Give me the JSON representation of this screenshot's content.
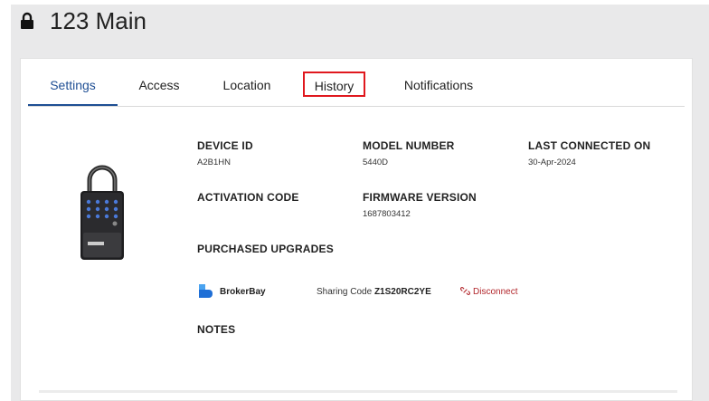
{
  "page": {
    "title": "123 Main"
  },
  "tabs": [
    {
      "label": "Settings"
    },
    {
      "label": "Access"
    },
    {
      "label": "Location"
    },
    {
      "label": "History"
    },
    {
      "label": "Notifications"
    }
  ],
  "fields": {
    "device_id": {
      "label": "DEVICE ID",
      "value": "A2B1HN"
    },
    "model_number": {
      "label": "MODEL NUMBER",
      "value": "5440D"
    },
    "last_connected": {
      "label": "LAST CONNECTED ON",
      "value": "30-Apr-2024"
    },
    "activation_code": {
      "label": "ACTIVATION CODE"
    },
    "firmware_version": {
      "label": "FIRMWARE VERSION",
      "value": "1687803412"
    },
    "purchased_upgrades": {
      "label": "PURCHASED UPGRADES"
    },
    "notes": {
      "label": "NOTES"
    }
  },
  "upgrade": {
    "name": "BrokerBay",
    "sharing_prefix": "Sharing Code",
    "sharing_code": "Z1S20RC2YE",
    "disconnect_label": "Disconnect"
  },
  "icons": {
    "title": "lock-icon",
    "upgrade": "brokerbay-logo-icon",
    "disconnect": "unlink-icon"
  },
  "colors": {
    "active_tab": "#1f4f94",
    "highlight_border": "#e0181e",
    "disconnect": "#b2262b",
    "brokerbay_blue": "#2b7de9"
  }
}
